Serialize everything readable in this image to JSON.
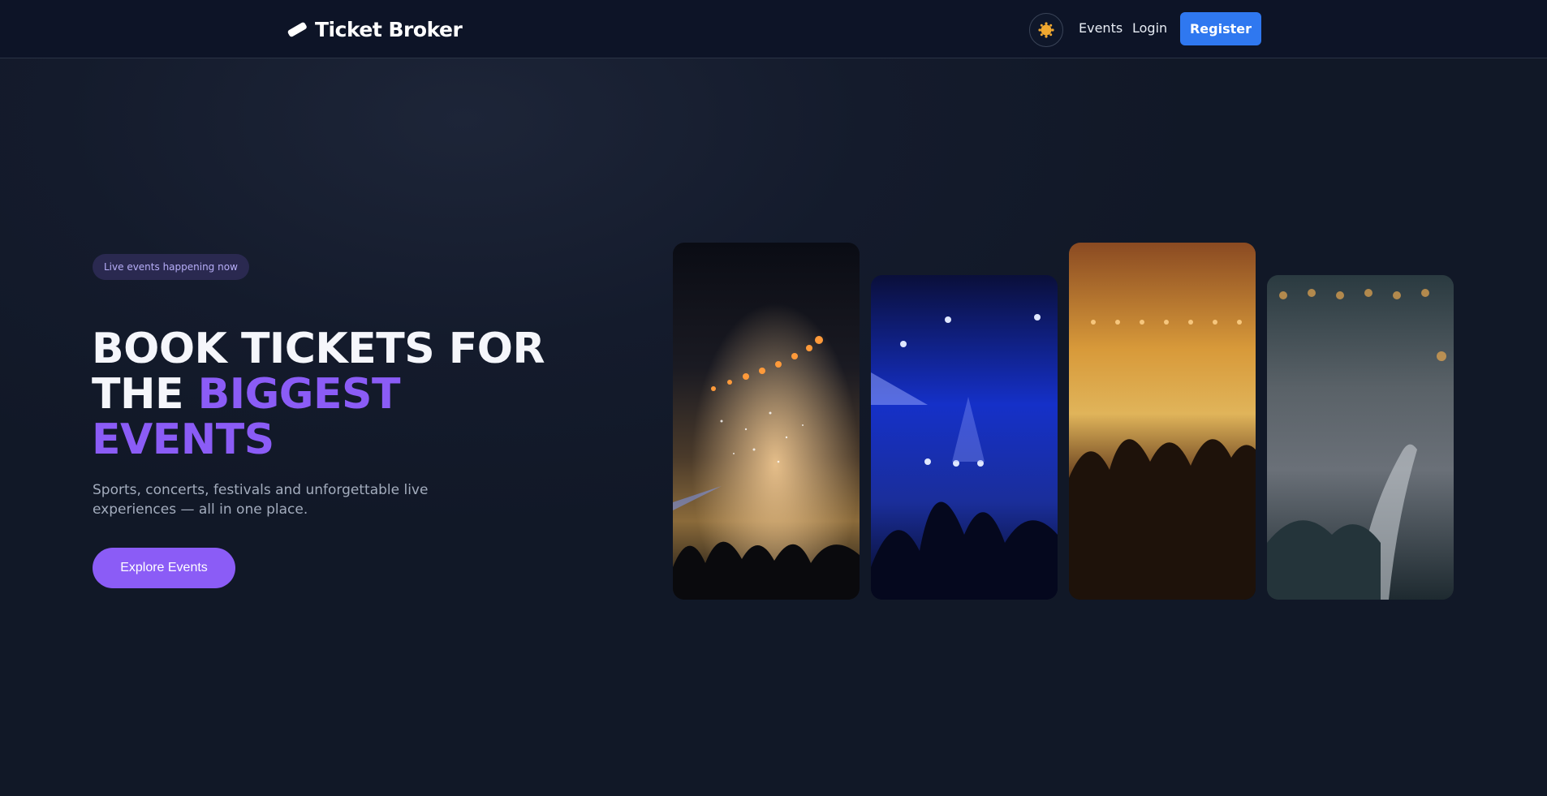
{
  "header": {
    "brand": "Ticket Broker",
    "theme_toggle_icon": "sun-icon",
    "nav": {
      "events": "Events",
      "login": "Login",
      "register": "Register"
    }
  },
  "hero": {
    "badge": "Live events happening now",
    "headline_part1": "Book tickets for the ",
    "headline_accent": "biggest events",
    "subtitle": "Sports, concerts, festivals and unforgettable live experiences — all in one place.",
    "cta": "Explore Events"
  },
  "gallery": [
    {
      "name": "concert-fireworks-image"
    },
    {
      "name": "blue-stage-lights-image"
    },
    {
      "name": "orange-crowd-image"
    },
    {
      "name": "crowd-hands-image"
    }
  ],
  "colors": {
    "accent": "#8b5cf6",
    "primary": "#2f78f0",
    "background": "#111827",
    "header_bg": "#0d1427"
  }
}
